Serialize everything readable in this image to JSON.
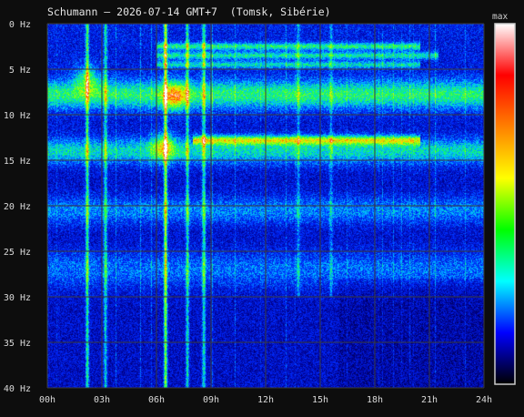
{
  "header": {
    "title": "Schumann — 2026-07-14 GMT+7  (Tomsk, Sibérie)",
    "colorbar_label": "max"
  },
  "chart_data": {
    "type": "heatmap",
    "title": "Schumann — 2026-07-14 GMT+7  (Tomsk, Sibérie)",
    "xlabel": "",
    "ylabel": "",
    "x_unit": "hours",
    "y_unit": "Hz",
    "xlim": [
      0,
      24
    ],
    "ylim": [
      0,
      40
    ],
    "x_ticks": [
      0,
      3,
      6,
      9,
      12,
      15,
      18,
      21,
      24
    ],
    "x_tick_labels": [
      "00h",
      "03h",
      "06h",
      "09h",
      "12h",
      "15h",
      "18h",
      "21h",
      "24h"
    ],
    "y_ticks": [
      0,
      5,
      10,
      15,
      20,
      25,
      30,
      35,
      40
    ],
    "y_tick_labels": [
      "0 Hz",
      "5 Hz",
      "10 Hz",
      "15 Hz",
      "20 Hz",
      "25 Hz",
      "30 Hz",
      "35 Hz",
      "40 Hz"
    ],
    "grid": true,
    "colorbar": {
      "label": "max",
      "colormap": "jet",
      "colors": [
        "#000000",
        "#0000ff",
        "#00ffff",
        "#00ff00",
        "#ffff00",
        "#ff8000",
        "#ff0000",
        "#ffffff"
      ]
    },
    "bands": [
      {
        "freq_hz": 7.8,
        "intensity": 0.6,
        "width_hz": 1.6,
        "x_start": 0,
        "x_end": 24
      },
      {
        "freq_hz": 14.0,
        "intensity": 0.5,
        "width_hz": 1.4,
        "x_start": 0,
        "x_end": 24
      },
      {
        "freq_hz": 12.8,
        "intensity": 0.75,
        "width_hz": 0.5,
        "x_start": 8.0,
        "x_end": 20.5
      },
      {
        "freq_hz": 20.5,
        "intensity": 0.32,
        "width_hz": 1.5,
        "x_start": 0,
        "x_end": 24
      },
      {
        "freq_hz": 27.0,
        "intensity": 0.28,
        "width_hz": 2.0,
        "x_start": 0,
        "x_end": 24
      },
      {
        "freq_hz": 2.5,
        "intensity": 0.55,
        "width_hz": 0.4,
        "x_start": 6.0,
        "x_end": 20.5
      },
      {
        "freq_hz": 3.5,
        "intensity": 0.5,
        "width_hz": 0.4,
        "x_start": 6.0,
        "x_end": 21.5
      },
      {
        "freq_hz": 4.5,
        "intensity": 0.45,
        "width_hz": 0.4,
        "x_start": 6.0,
        "x_end": 20.5
      }
    ],
    "spikes": [
      {
        "hour": 2.2,
        "intensity": 0.7,
        "freq_max": 40
      },
      {
        "hour": 3.2,
        "intensity": 0.55,
        "freq_max": 40
      },
      {
        "hour": 6.5,
        "intensity": 0.95,
        "freq_max": 40
      },
      {
        "hour": 7.7,
        "intensity": 0.6,
        "freq_max": 40
      },
      {
        "hour": 8.6,
        "intensity": 0.6,
        "freq_max": 40
      },
      {
        "hour": 13.8,
        "intensity": 0.35,
        "freq_max": 30
      },
      {
        "hour": 15.6,
        "intensity": 0.3,
        "freq_max": 30
      }
    ],
    "hotspots": [
      {
        "hour": 7.0,
        "freq_hz": 8.0,
        "intensity": 1.0
      },
      {
        "hour": 6.4,
        "freq_hz": 13.5,
        "intensity": 0.9
      },
      {
        "hour": 2.2,
        "freq_hz": 6.0,
        "intensity": 0.8
      }
    ]
  }
}
